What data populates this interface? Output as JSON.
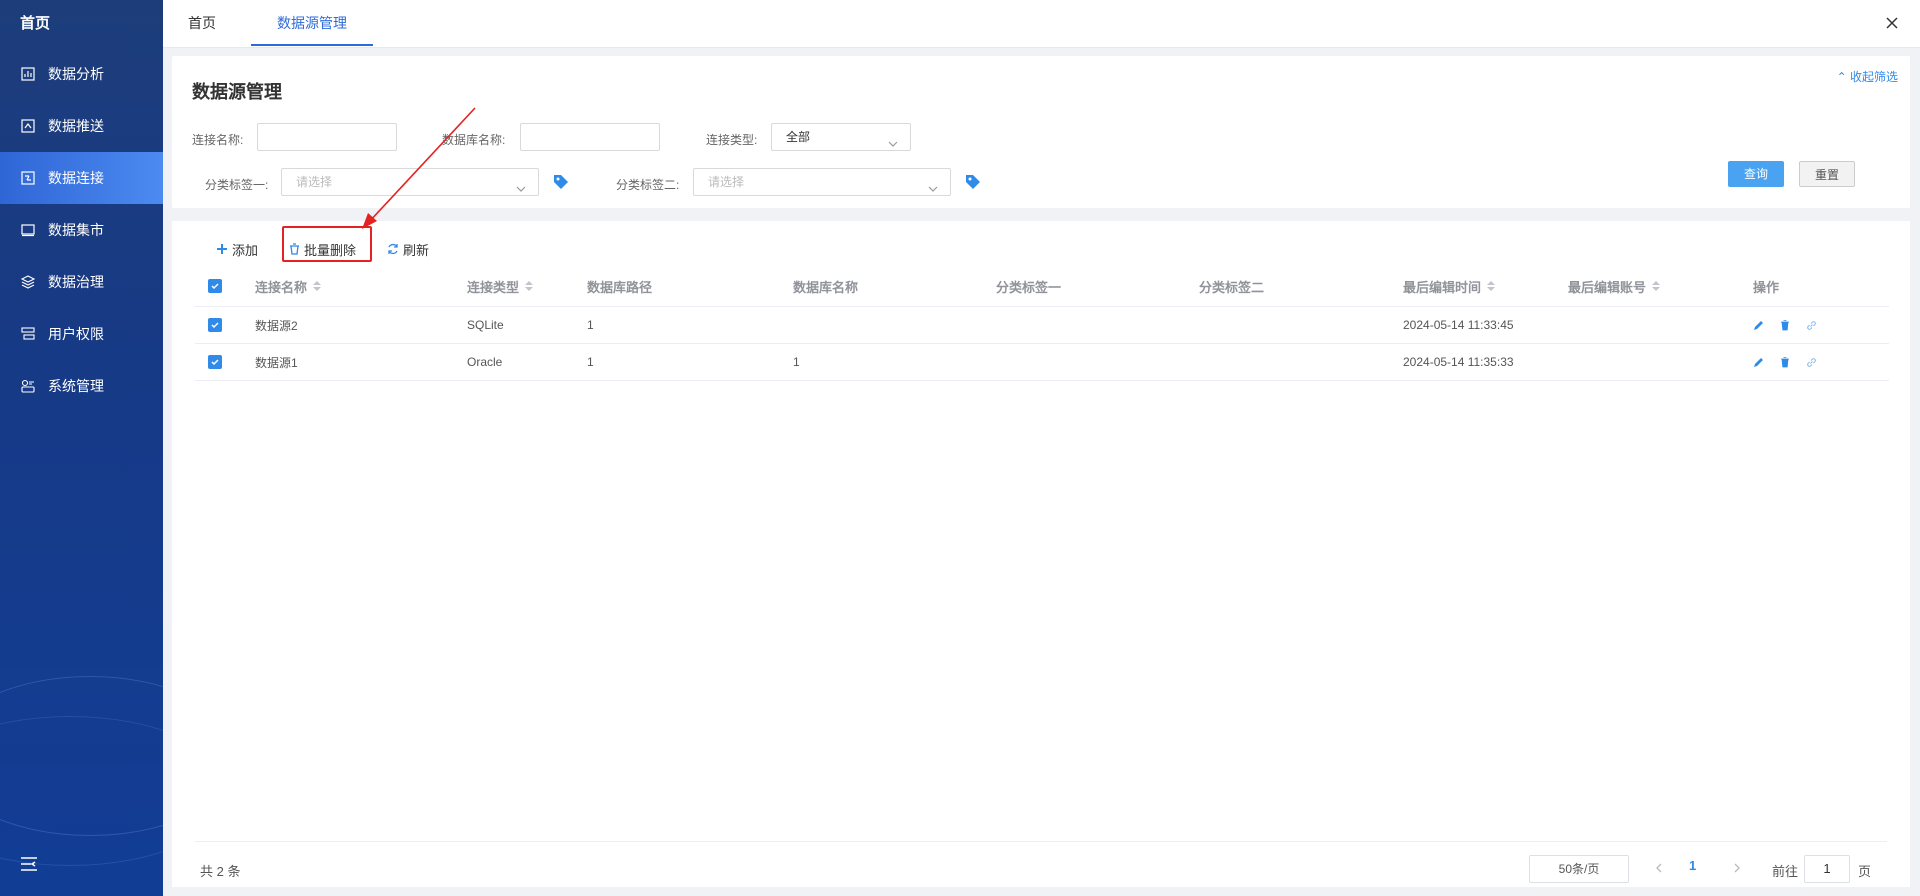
{
  "sidebar": {
    "home": "首页",
    "items": [
      {
        "label": "数据分析",
        "icon": "chart-icon"
      },
      {
        "label": "数据推送",
        "icon": "push-icon"
      },
      {
        "label": "数据连接",
        "icon": "connection-icon",
        "active": true
      },
      {
        "label": "数据集市",
        "icon": "market-icon"
      },
      {
        "label": "数据治理",
        "icon": "layers-icon"
      },
      {
        "label": "用户权限",
        "icon": "user-permission-icon"
      },
      {
        "label": "系统管理",
        "icon": "system-icon"
      }
    ],
    "bottom_icon": "menu-collapse-icon"
  },
  "tabs": [
    {
      "label": "首页"
    },
    {
      "label": "数据源管理",
      "active": true
    }
  ],
  "filter": {
    "title": "数据源管理",
    "collapse_label": "收起筛选",
    "conn_name_label": "连接名称:",
    "conn_name_value": "",
    "db_name_label": "数据库名称:",
    "db_name_value": "",
    "conn_type_label": "连接类型:",
    "conn_type_value": "全部",
    "tag1_label": "分类标签一:",
    "tag1_placeholder": "请选择",
    "tag2_label": "分类标签二:",
    "tag2_placeholder": "请选择",
    "query_label": "查询",
    "reset_label": "重置"
  },
  "toolbar": {
    "add_label": "添加",
    "batch_delete_label": "批量删除",
    "refresh_label": "刷新"
  },
  "table": {
    "columns": [
      "连接名称",
      "连接类型",
      "数据库路径",
      "数据库名称",
      "分类标签一",
      "分类标签二",
      "最后编辑时间",
      "最后编辑账号",
      "操作"
    ],
    "rows": [
      {
        "name": "数据源2",
        "type": "SQLite",
        "path": "1",
        "db": "",
        "tag1": "",
        "tag2": "",
        "time": "2024-05-14 11:33:45",
        "account": ""
      },
      {
        "name": "数据源1",
        "type": "Oracle",
        "path": "1",
        "db": "1",
        "tag1": "",
        "tag2": "",
        "time": "2024-05-14 11:35:33",
        "account": ""
      }
    ]
  },
  "pagination": {
    "total": "共 2 条",
    "page_size": "50条/页",
    "current": "1",
    "goto_label": "前往",
    "goto_value": "1",
    "unit": "页"
  },
  "colors": {
    "accent": "#2f8ae8",
    "sidebar_bg": "#173a86",
    "highlight": "#e32222"
  }
}
